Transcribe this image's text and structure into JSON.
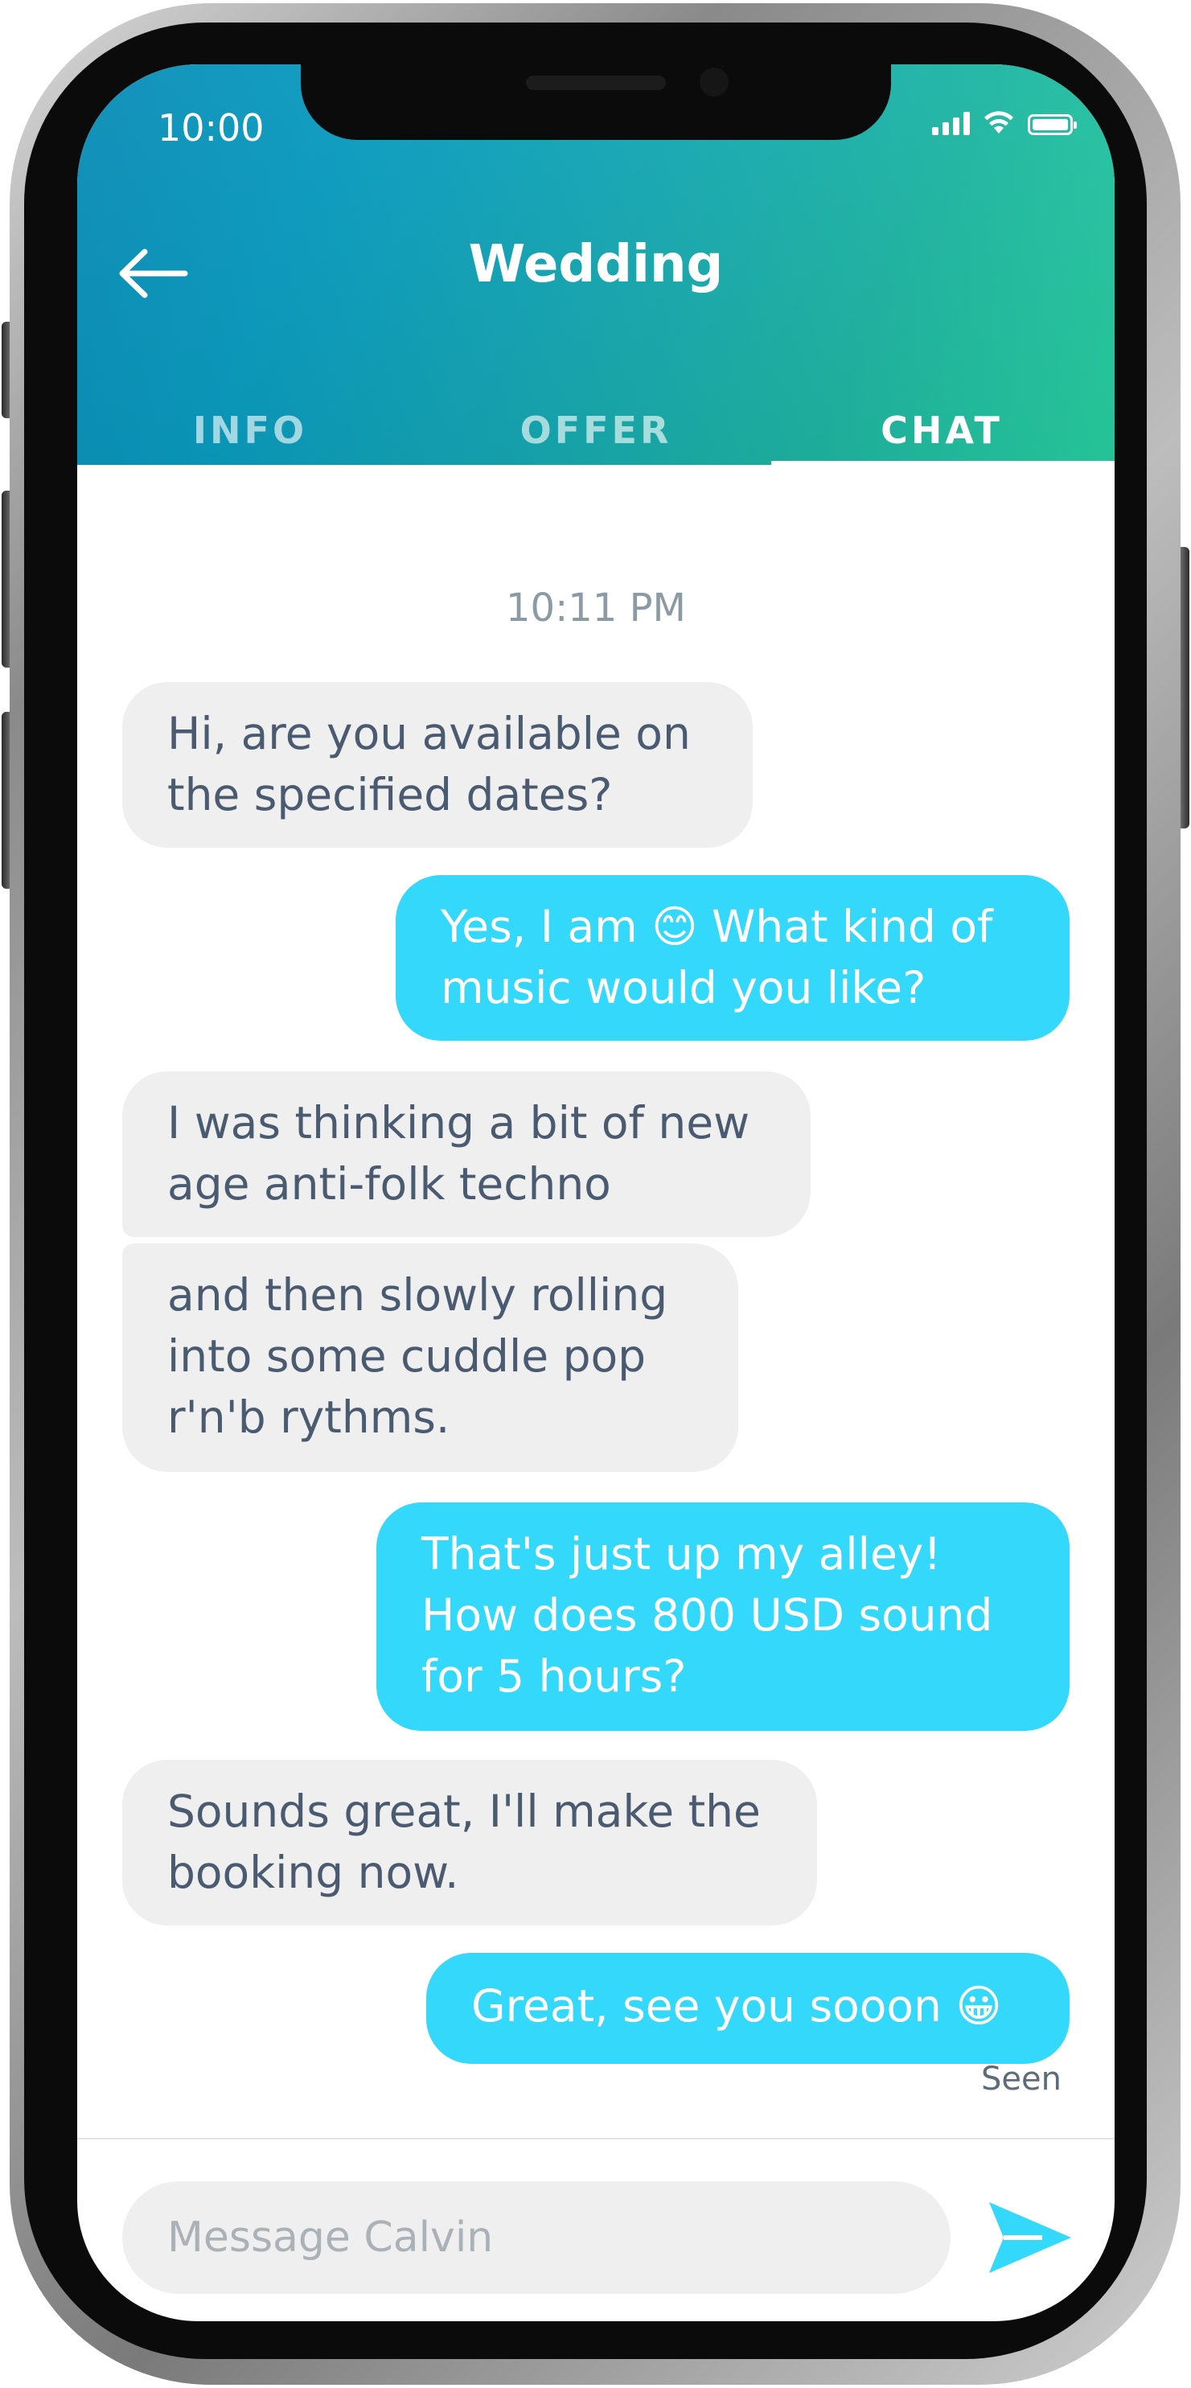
{
  "status_bar": {
    "time": "10:00",
    "signal_icon": "cellular-signal-icon",
    "wifi_icon": "wifi-icon",
    "battery_icon": "battery-icon"
  },
  "header": {
    "back_icon": "arrow-left-icon",
    "title": "Wedding",
    "tabs": [
      {
        "label": "INFO",
        "active": false
      },
      {
        "label": "OFFER",
        "active": false
      },
      {
        "label": "CHAT",
        "active": true
      }
    ]
  },
  "chat": {
    "timestamp": "10:11 PM",
    "messages": [
      {
        "from": "them",
        "text": "Hi, are you available on\nthe specified dates?"
      },
      {
        "from": "me",
        "text": "Yes, I am 😊 What kind of\nmusic would you like?"
      },
      {
        "from": "them",
        "text": "I was thinking a bit of new\nage anti-folk techno"
      },
      {
        "from": "them",
        "text": "and then slowly rolling\ninto some cuddle pop\nr'n'b rythms."
      },
      {
        "from": "me",
        "text": "That's just up my alley!\nHow does 800 USD sound\nfor 5 hours?"
      },
      {
        "from": "them",
        "text": "Sounds great, I'll make the\nbooking now."
      },
      {
        "from": "me",
        "text": "Great, see you sooon 😀"
      }
    ],
    "receipt": "Seen"
  },
  "composer": {
    "placeholder": "Message Calvin",
    "value": "",
    "send_icon": "send-icon"
  },
  "colors": {
    "header_gradient_start": "#0b8db8",
    "header_gradient_end": "#27cf9f",
    "outgoing_bubble": "#33d8fa",
    "incoming_bubble": "#efefef",
    "incoming_text": "#4a5a70",
    "send_icon": "#33d8fa"
  }
}
